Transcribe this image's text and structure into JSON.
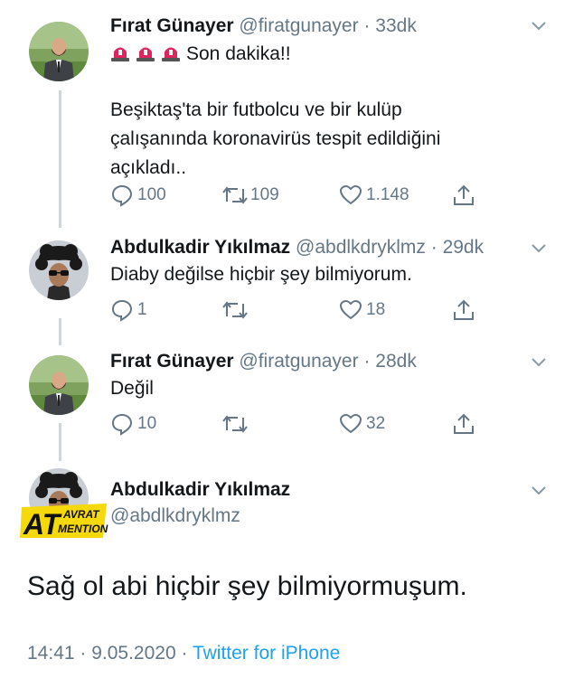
{
  "thread": [
    {
      "name": "Fırat Günayer",
      "handle": "@firatgunayer",
      "sep": "·",
      "time": "33dk",
      "alert_text": "Son dakika!!",
      "body_lines": [
        "Beşiktaş'ta bir futbolcu ve bir kulüp",
        "çalışanında koronavirüs tespit edildiğini",
        "açıkladı.."
      ],
      "replies": "100",
      "retweets": "109",
      "likes": "1.148"
    },
    {
      "name": "Abdulkadir Yıkılmaz",
      "handle": "@abdlkdryklmz",
      "sep": "·",
      "time": "29dk",
      "body": "Diaby değilse hiçbir şey bilmiyorum.",
      "replies": "1",
      "likes": "18"
    },
    {
      "name": "Fırat Günayer",
      "handle": "@firatgunayer",
      "sep": "·",
      "time": "28dk",
      "body": "Değil",
      "replies": "10",
      "likes": "32"
    }
  ],
  "main_tweet": {
    "name": "Abdulkadir Yıkılmaz",
    "handle": "@abdlkdryklmz",
    "text": "Sağ ol abi hiçbir şey bilmiyormuşum.",
    "timestamp": "14:41 · 9.05.2020 ·",
    "source": "Twitter for iPhone"
  },
  "watermark": {
    "big": "AT",
    "top": "AVRAT",
    "bottom": "MENTION",
    "bg_color": "#f5d90a"
  },
  "colors": {
    "muted": "#657786",
    "link": "#1da1f2",
    "thread_line": "#ccd6dd",
    "alarm_red": "#e0245e"
  },
  "icons": [
    "chevron-down-icon",
    "reply-icon",
    "retweet-icon",
    "like-icon",
    "share-icon",
    "alarm-icon"
  ]
}
